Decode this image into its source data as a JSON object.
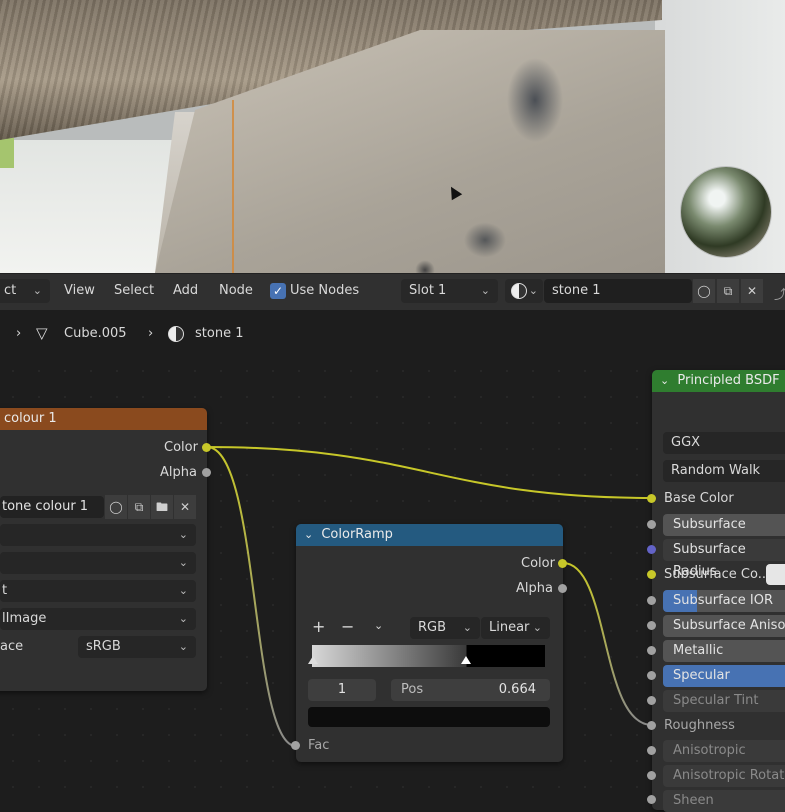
{
  "header": {
    "mode_fragment": "ct",
    "menus": [
      "View",
      "Select",
      "Add",
      "Node"
    ],
    "use_nodes_label": "Use Nodes",
    "slot_value": "Slot 1",
    "material_name": "stone 1"
  },
  "breadcrumb": {
    "object": "Cube.005",
    "material": "stone 1"
  },
  "image_node": {
    "title_fragment": "colour 1",
    "outputs": [
      "Color",
      "Alpha"
    ],
    "image_name": "tone colour 1",
    "rows": [
      "",
      "",
      "t",
      "lImage"
    ],
    "colorspace_label": "ace",
    "colorspace_value": "sRGB"
  },
  "colorramp_node": {
    "title": "ColorRamp",
    "outputs": [
      "Color",
      "Alpha"
    ],
    "color_mode": "RGB",
    "interpolation": "Linear",
    "index": "1",
    "pos_label": "Pos",
    "pos_value": "0.664",
    "fac_label": "Fac"
  },
  "bsdf_node": {
    "title": "Principled BSDF",
    "distribution": "GGX",
    "subsurface_method": "Random Walk",
    "inputs": [
      "Base Color",
      "Subsurface",
      "Subsurface Radius",
      "Subsurface Co...",
      "Subsurface IOR",
      "Subsurface Anisotr",
      "Metallic",
      "Specular",
      "Specular Tint",
      "Roughness",
      "Anisotropic",
      "Anisotropic Rotatio",
      "Sheen"
    ]
  },
  "colors": {
    "image_header": "#8a4a1e",
    "colorramp_header": "#245a80",
    "bsdf_header": "#2f7d2f",
    "wire": "#c7c729",
    "accent": "#4772b3"
  }
}
